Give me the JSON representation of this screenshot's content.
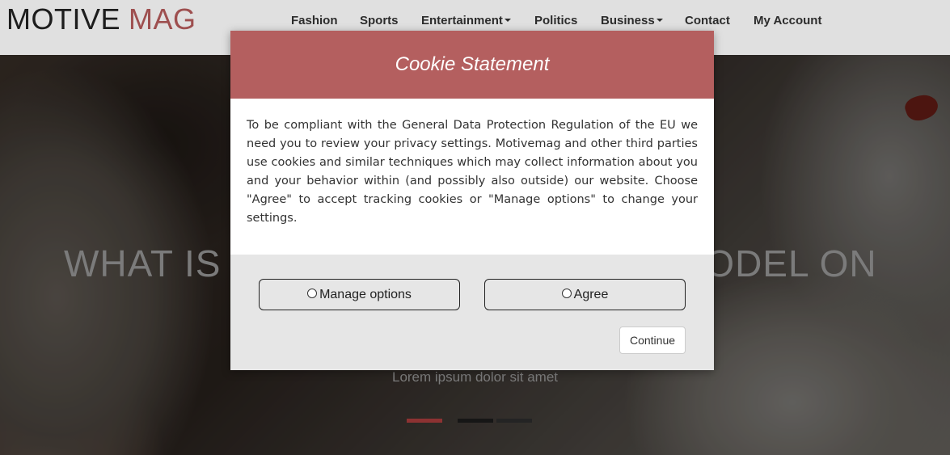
{
  "site": {
    "logo_part1": "MOTIVE",
    "logo_part2": "MAG",
    "accent_color": "#b45a5a"
  },
  "nav": {
    "items": [
      {
        "label": "Fashion",
        "has_dropdown": false
      },
      {
        "label": "Sports",
        "has_dropdown": false
      },
      {
        "label": "Entertainment",
        "has_dropdown": true
      },
      {
        "label": "Politics",
        "has_dropdown": false
      },
      {
        "label": "Business",
        "has_dropdown": true
      },
      {
        "label": "Contact",
        "has_dropdown": false
      },
      {
        "label": "My Account",
        "has_dropdown": false
      }
    ]
  },
  "hero": {
    "title_left": "WHAT IS I",
    "title_right": "MODEL ON",
    "subtitle": "Lorem ipsum dolor sit amet",
    "indicator_colors": [
      "#a13a3a",
      "#1a1a1a",
      "#2a2a2a"
    ]
  },
  "cookie_modal": {
    "title": "Cookie Statement",
    "header_color": "#b45f5f",
    "body": "To be compliant with the General Data Protection Regulation of the EU we need you to review your privacy settings. Motivemag and other third parties use cookies and similar techniques which may collect information about you and your behavior within (and possibly also outside) our website. Choose \"Agree\" to accept tracking cookies or \"Manage options\" to change your settings.",
    "manage_label": "Manage options",
    "agree_label": "Agree",
    "continue_label": "Continue"
  }
}
